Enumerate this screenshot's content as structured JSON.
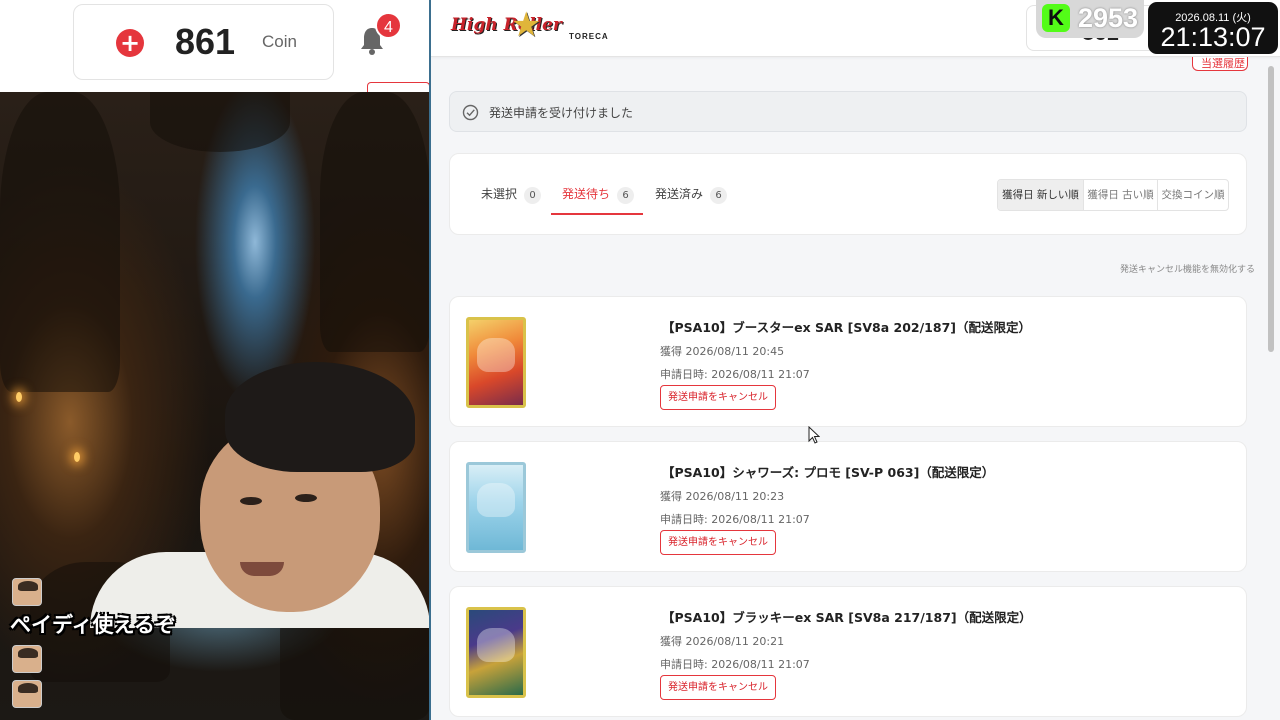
{
  "stream": {
    "coin_amount": "861",
    "coin_unit": "Coin",
    "notification_count": "4",
    "chat_message": "ペイディ使えるぞ"
  },
  "app": {
    "logo_main": "High Roller",
    "logo_sub": "TORECA",
    "header_coin": "861",
    "history_button_label": "当選履歴",
    "notice_text": "発送申請を受け付けました",
    "tabs": [
      {
        "label": "未選択",
        "count": "0"
      },
      {
        "label": "発送待ち",
        "count": "6"
      },
      {
        "label": "発送済み",
        "count": "6"
      }
    ],
    "sort_options": [
      "獲得日 新しい順",
      "獲得日 古い順",
      "交換コイン順"
    ],
    "disable_cancel_label": "発送キャンセル機能を無効化する",
    "items": [
      {
        "title": "【PSA10】ブースターex SAR [SV8a 202/187]（配送限定）",
        "acquired": "獲得 2026/08/11 20:45",
        "requested": "申請日時: 2026/08/11 21:07",
        "cancel_label": "発送申請をキャンセル"
      },
      {
        "title": "【PSA10】シャワーズ: プロモ [SV-P 063]（配送限定）",
        "acquired": "獲得 2026/08/11 20:23",
        "requested": "申請日時: 2026/08/11 21:07",
        "cancel_label": "発送申請をキャンセル"
      },
      {
        "title": "【PSA10】ブラッキーex SAR [SV8a 217/187]（配送限定）",
        "acquired": "獲得 2026/08/11 20:21",
        "requested": "申請日時: 2026/08/11 21:07",
        "cancel_label": "発送申請をキャンセル"
      }
    ]
  },
  "overlay": {
    "kick_logo": "K",
    "viewer_count": "2953",
    "date": "2026.08.11 (火)",
    "time": "21:13:07"
  },
  "colors": {
    "accent_red": "#e5363d",
    "kick_green": "#53fc18"
  }
}
